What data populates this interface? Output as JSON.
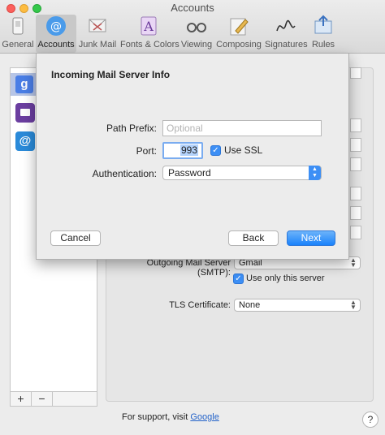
{
  "window": {
    "title": "Accounts"
  },
  "toolbar": {
    "items": [
      {
        "label": "General",
        "icon": "general-icon"
      },
      {
        "label": "Accounts",
        "icon": "at-sign-icon"
      },
      {
        "label": "Junk Mail",
        "icon": "junk-mail-icon"
      },
      {
        "label": "Fonts & Colors",
        "icon": "fonts-colors-icon"
      },
      {
        "label": "Viewing",
        "icon": "glasses-icon"
      },
      {
        "label": "Composing",
        "icon": "pencil-icon"
      },
      {
        "label": "Signatures",
        "icon": "signature-icon"
      },
      {
        "label": "Rules",
        "icon": "rules-icon"
      }
    ]
  },
  "sidebar": {
    "accounts": [
      {
        "icon": "google-icon",
        "glyph": "g"
      },
      {
        "icon": "envelope-icon",
        "glyph": ""
      },
      {
        "icon": "at-sign-icon",
        "glyph": "@"
      }
    ],
    "add_label": "+",
    "remove_label": "−"
  },
  "account_settings": {
    "outgoing_server_label": "Outgoing Mail Server (SMTP):",
    "outgoing_server_value": "Gmail",
    "use_only_label": "Use only this server",
    "tls_label": "TLS Certificate:",
    "tls_value": "None"
  },
  "support": {
    "prefix": "For support, visit ",
    "link": "Google"
  },
  "help_label": "?",
  "sheet": {
    "title": "Incoming Mail Server Info",
    "path_prefix_label": "Path Prefix:",
    "path_prefix_placeholder": "Optional",
    "port_label": "Port:",
    "port_value": "993",
    "use_ssl_label": "Use SSL",
    "auth_label": "Authentication:",
    "auth_value": "Password",
    "cancel_label": "Cancel",
    "back_label": "Back",
    "next_label": "Next"
  },
  "colors": {
    "accent": "#1a82fb",
    "selection": "#b7c5e6"
  }
}
